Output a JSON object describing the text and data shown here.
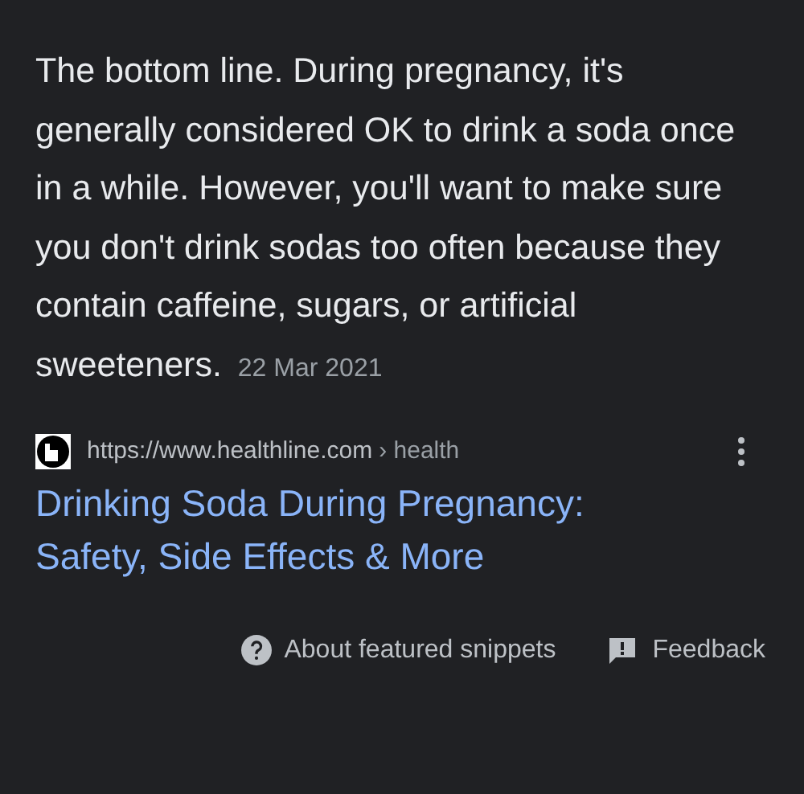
{
  "snippet": {
    "text": "The bottom line. During pregnancy, it's generally considered OK to drink a soda once in a while. However, you'll want to make sure you don't drink sodas too often because they contain caffeine, sugars, or artificial sweeteners.",
    "date": "22 Mar 2021"
  },
  "source": {
    "url": "https://www.healthline.com",
    "breadcrumb": "› health"
  },
  "title": "Drinking Soda During Pregnancy: Safety, Side Effects & More",
  "footer": {
    "about": "About featured snippets",
    "feedback": "Feedback"
  }
}
